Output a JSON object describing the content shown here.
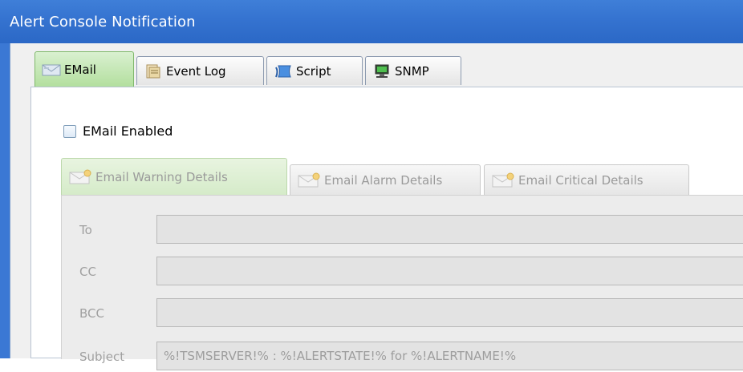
{
  "window": {
    "title": "Alert Console Notification"
  },
  "tabs": [
    {
      "label": "EMail",
      "icon": "email-icon",
      "active": true
    },
    {
      "label": "Event Log",
      "icon": "event-log-icon",
      "active": false
    },
    {
      "label": "Script",
      "icon": "script-icon",
      "active": false
    },
    {
      "label": "SNMP",
      "icon": "snmp-icon",
      "active": false
    }
  ],
  "email": {
    "enabled_label": "EMail Enabled",
    "enabled": false,
    "subtabs": [
      {
        "label": "Email Warning Details",
        "icon": "envelope-icon",
        "active": true
      },
      {
        "label": "Email Alarm Details",
        "icon": "envelope-icon",
        "active": false
      },
      {
        "label": "Email Critical Details",
        "icon": "envelope-icon",
        "active": false
      }
    ],
    "fields": {
      "to": {
        "label": "To",
        "value": ""
      },
      "cc": {
        "label": "CC",
        "value": ""
      },
      "bcc": {
        "label": "BCC",
        "value": ""
      },
      "subject": {
        "label": "Subject",
        "value": "%!TSMSERVER!% : %!ALERTSTATE!% for %!ALERTNAME!%"
      }
    }
  },
  "colors": {
    "title_bar": "#3573d0",
    "active_tab": "#b3df9e",
    "disabled_text": "#9d9d9d"
  }
}
